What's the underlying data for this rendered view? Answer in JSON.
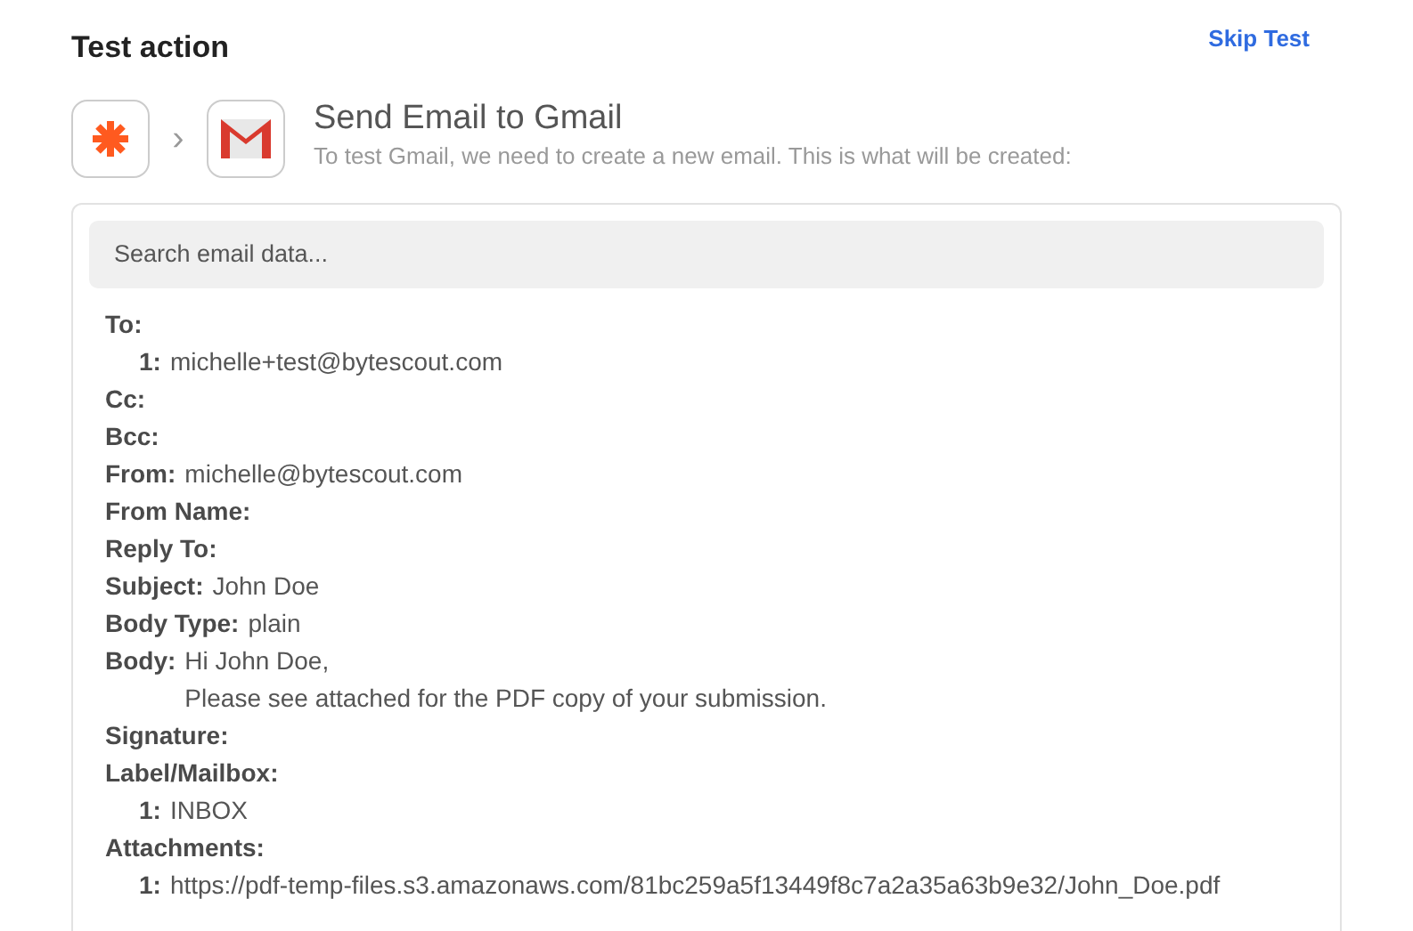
{
  "header": {
    "title": "Test action",
    "skip_link": "Skip Test"
  },
  "step": {
    "separator": "›",
    "title": "Send Email to Gmail",
    "subtitle": "To test Gmail, we need to create a new email. This is what will be created:"
  },
  "search": {
    "placeholder": "Search email data..."
  },
  "fields": [
    {
      "label": "To:",
      "items": [
        {
          "index": "1:",
          "value": "michelle+test@bytescout.com"
        }
      ]
    },
    {
      "label": "Cc:"
    },
    {
      "label": "Bcc:"
    },
    {
      "label": "From:",
      "lines": [
        "michelle@bytescout.com"
      ]
    },
    {
      "label": "From Name:"
    },
    {
      "label": "Reply To:"
    },
    {
      "label": "Subject:",
      "lines": [
        "John Doe"
      ]
    },
    {
      "label": "Body Type:",
      "lines": [
        "plain"
      ]
    },
    {
      "label": "Body:",
      "lines": [
        "Hi John Doe,",
        "Please see attached for the PDF copy of your submission."
      ]
    },
    {
      "label": "Signature:"
    },
    {
      "label": "Label/Mailbox:",
      "items": [
        {
          "index": "1:",
          "value": "INBOX"
        }
      ]
    },
    {
      "label": "Attachments:",
      "items": [
        {
          "index": "1:",
          "value": "https://pdf-temp-files.s3.amazonaws.com/81bc259a5f13449f8c7a2a35a63b9e32/John_Doe.pdf"
        }
      ]
    }
  ]
}
